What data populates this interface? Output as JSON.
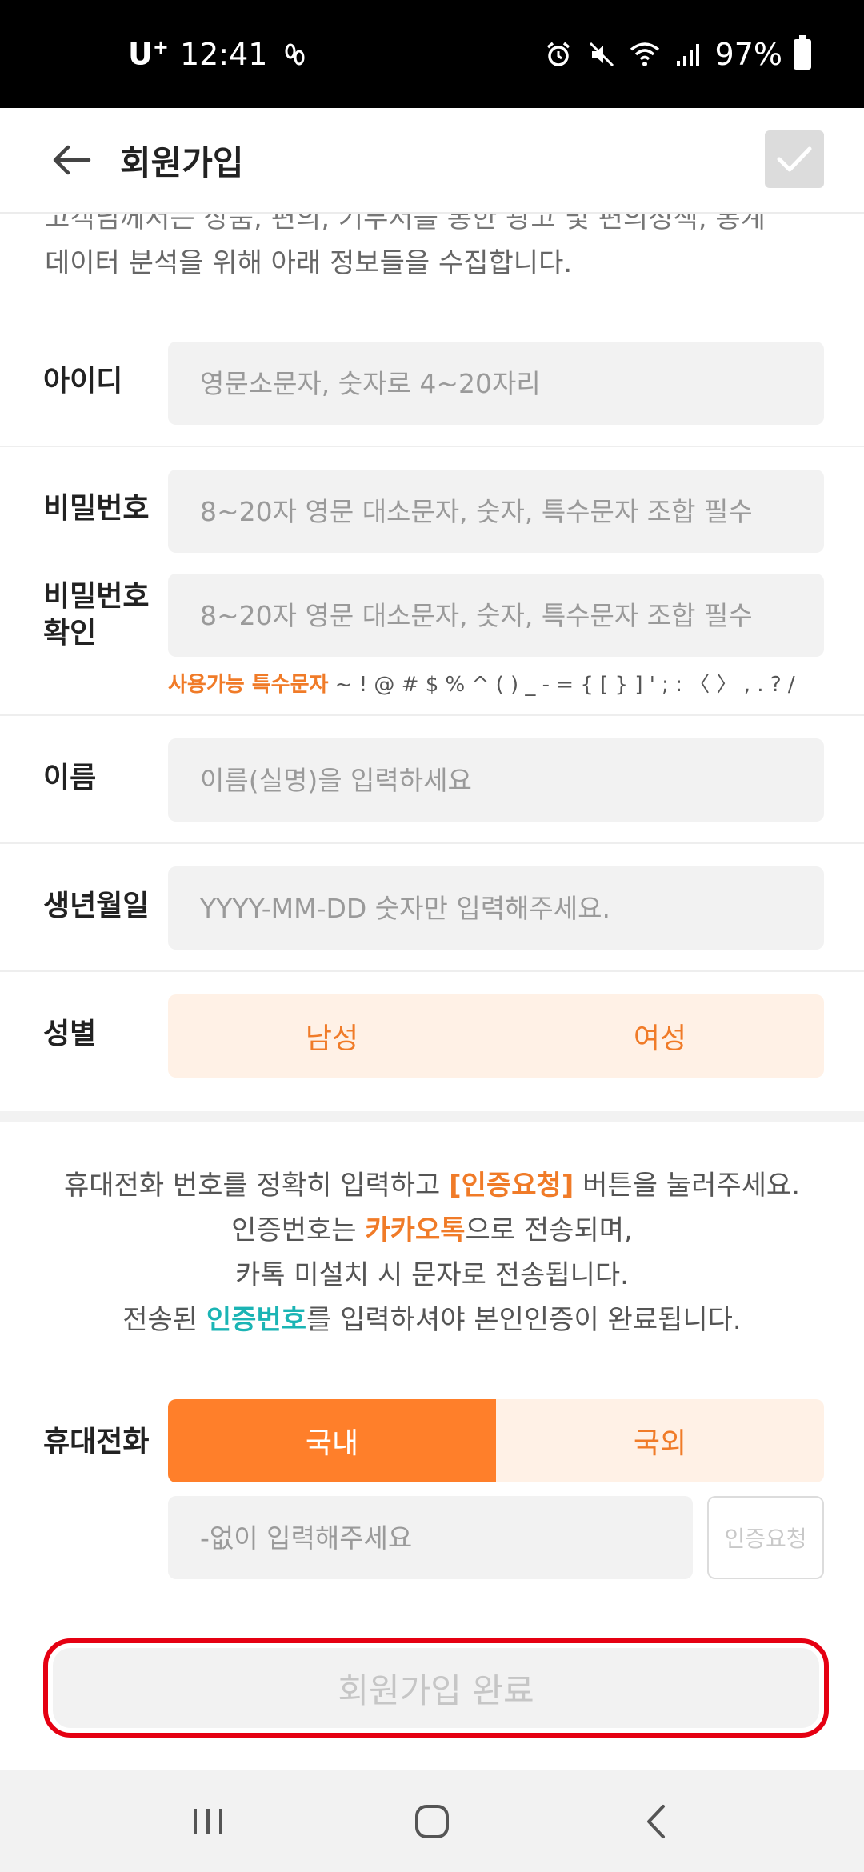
{
  "status_bar": {
    "carrier": "U",
    "carrier_sup": "+",
    "time": "12:41",
    "battery": "97%"
  },
  "app_bar": {
    "title": "회원가입"
  },
  "intro": {
    "cut_line": "고객님께서는 상품, 편의, 기부서를 통한 광고 및 편의정책, 통계",
    "line2": "데이터 분석을 위해 아래 정보들을 수집합니다."
  },
  "form": {
    "id_label": "아이디",
    "id_placeholder": "영문소문자, 숫자로 4~20자리",
    "password_label": "비밀번호",
    "password_placeholder": "8~20자 영문 대소문자, 숫자, 특수문자 조합 필수",
    "password_confirm_label_1": "비밀번호",
    "password_confirm_label_2": "확인",
    "password_confirm_placeholder": "8~20자 영문 대소문자, 숫자, 특수문자 조합 필수",
    "special_chars_label": "사용가능 특수문자",
    "special_chars_value": " ~ ! @ # $ % ^ ( ) _ - = { [ } ] ' ; : 〈 〉 , . ? /",
    "name_label": "이름",
    "name_placeholder": "이름(실명)을 입력하세요",
    "birth_label": "생년월일",
    "birth_placeholder": "YYYY-MM-DD 숫자만 입력해주세요.",
    "gender_label": "성별",
    "gender_male": "남성",
    "gender_female": "여성"
  },
  "notice": {
    "line1_a": "휴대전화 번호를 정확히 입력하고 ",
    "line1_highlight": "[인증요청]",
    "line1_b": " 버튼을 눌러주세요.",
    "line2_a": "인증번호는 ",
    "line2_highlight": "카카오톡",
    "line2_b": "으로 전송되며,",
    "line3": "카톡 미설치 시 문자로 전송됩니다.",
    "line4_a": "전송된 ",
    "line4_highlight": "인증번호",
    "line4_b": "를 입력하셔야 본인인증이 완료됩니다."
  },
  "phone": {
    "label": "휴대전화",
    "domestic": "국내",
    "overseas": "국외",
    "selected": "국내",
    "placeholder": "-없이 입력해주세요",
    "verify_button": "인증요청"
  },
  "submit": {
    "label": "회원가입 완료"
  },
  "colors": {
    "accent": "#ff7f2a",
    "accent_light": "#fff1e6",
    "highlight_border": "#e50012",
    "teal": "#1bb4b4"
  }
}
